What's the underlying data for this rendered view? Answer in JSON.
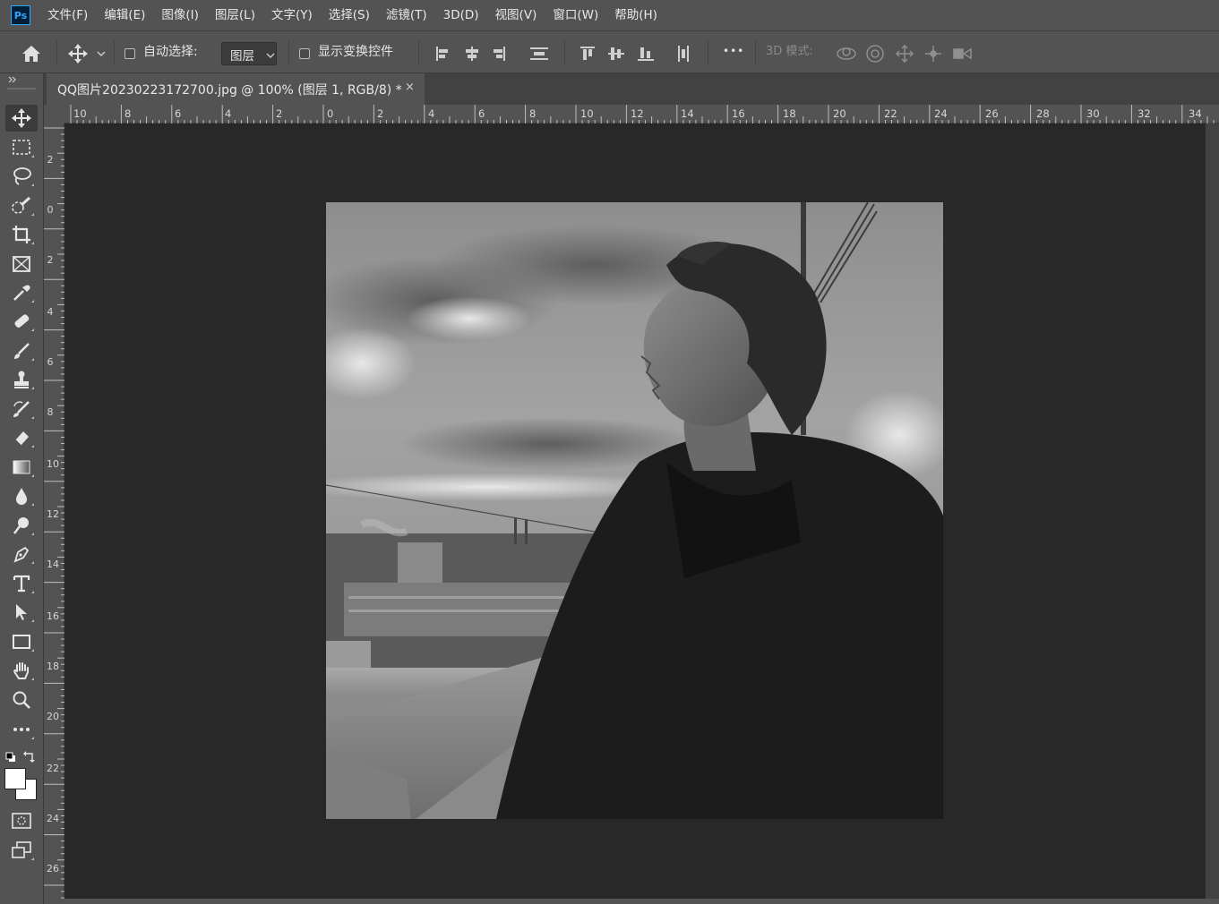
{
  "app": {
    "logo": "Ps"
  },
  "menu": [
    "文件(F)",
    "编辑(E)",
    "图像(I)",
    "图层(L)",
    "文字(Y)",
    "选择(S)",
    "滤镜(T)",
    "3D(D)",
    "视图(V)",
    "窗口(W)",
    "帮助(H)"
  ],
  "options": {
    "auto_select_label": "自动选择:",
    "auto_select_checked": false,
    "layer_select_value": "图层",
    "show_transform_label": "显示变换控件",
    "show_transform_checked": false,
    "more_label": "•••",
    "mode_3d_label": "3D 模式:"
  },
  "document": {
    "tab_title": "QQ图片20230223172700.jpg @ 100% (图层 1, RGB/8) *",
    "close_glyph": "×"
  },
  "ruler": {
    "top_labels": [
      "10",
      "8",
      "6",
      "4",
      "2",
      "0",
      "2",
      "4",
      "6",
      "8",
      "10",
      "12",
      "14",
      "16",
      "18",
      "20",
      "22",
      "24",
      "26",
      "28",
      "30",
      "32",
      "34"
    ],
    "left_labels": [
      "2",
      "0",
      "2",
      "4",
      "6",
      "8",
      "10",
      "12",
      "14",
      "16",
      "18",
      "20",
      "22",
      "24",
      "26"
    ]
  },
  "toolbar": {
    "tools": [
      "move-tool-icon",
      "marquee-tool-icon",
      "lasso-tool-icon",
      "quick-select-tool-icon",
      "crop-tool-icon",
      "frame-tool-icon",
      "eyedropper-tool-icon",
      "healing-brush-icon",
      "brush-tool-icon",
      "clone-stamp-icon",
      "history-brush-icon",
      "eraser-tool-icon",
      "gradient-tool-icon",
      "blur-tool-icon",
      "dodge-tool-icon",
      "pen-tool-icon",
      "type-tool-icon",
      "path-select-icon",
      "rectangle-tool-icon",
      "hand-tool-icon",
      "zoom-tool-icon",
      "more-tools-icon"
    ],
    "foreground_color": "#ffffff",
    "background_color": "#ffffff"
  },
  "colors": {
    "chrome": "#535353",
    "workspace": "#282828",
    "accent": "#31a8ff"
  }
}
